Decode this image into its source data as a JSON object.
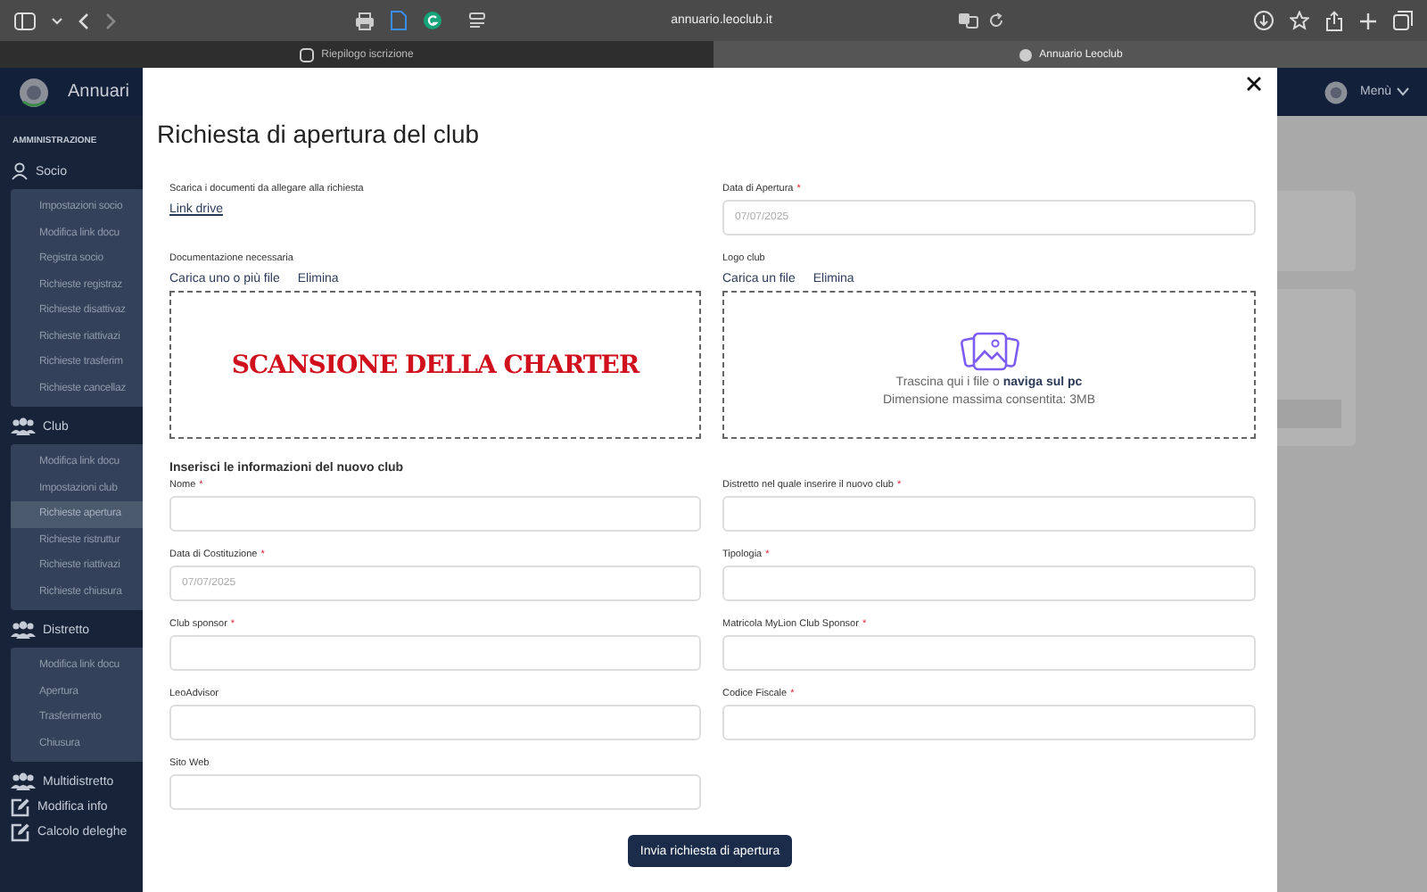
{
  "browser": {
    "url": "annuario.leoclub.it",
    "tabs": [
      {
        "label": "Riepilogo iscrizione",
        "selected": false
      },
      {
        "label": "Annuario Leoclub",
        "selected": true
      }
    ]
  },
  "app_header": {
    "title": "Annuari",
    "menu_label": "Menù"
  },
  "sidebar": {
    "section": "AMMINISTRAZIONE",
    "items": [
      {
        "label": "Socio",
        "kind": "person",
        "children": [
          {
            "label": "Impostazioni socio",
            "selected": false
          },
          {
            "label": "Modifica link docu",
            "selected": false
          },
          {
            "label": "Registra socio",
            "selected": false
          },
          {
            "label": "Richieste registraz",
            "selected": false
          },
          {
            "label": "Richieste disattivaz",
            "selected": false
          },
          {
            "label": "Richieste riattivazi",
            "selected": false
          },
          {
            "label": "Richieste trasferim",
            "selected": false
          },
          {
            "label": "Richieste cancellaz",
            "selected": false
          }
        ]
      },
      {
        "label": "Club",
        "kind": "group",
        "children": [
          {
            "label": "Modifica link docu",
            "selected": false
          },
          {
            "label": "Impostazioni club",
            "selected": false
          },
          {
            "label": "Richieste apertura",
            "selected": true
          },
          {
            "label": "Richieste ristruttur",
            "selected": false
          },
          {
            "label": "Richieste riattivazi",
            "selected": false
          },
          {
            "label": "Richieste chiusura",
            "selected": false
          }
        ]
      },
      {
        "label": "Distretto",
        "kind": "group",
        "children": [
          {
            "label": "Modifica link docu",
            "selected": false
          },
          {
            "label": "Apertura",
            "selected": false
          },
          {
            "label": "Trasferimento",
            "selected": false
          },
          {
            "label": "Chiusura",
            "selected": false
          }
        ]
      },
      {
        "label": "Multidistretto",
        "kind": "group"
      },
      {
        "label": "Modifica info",
        "kind": "edit"
      },
      {
        "label": "Calcolo deleghe",
        "kind": "edit"
      }
    ]
  },
  "modal": {
    "title": "Richiesta di apertura del club",
    "docs": {
      "label": "Scarica i documenti da allegare alla richiesta",
      "link": "Link drive"
    },
    "opening_date": {
      "label": "Data di Apertura",
      "required_mark": "*",
      "value": "07/07/2025"
    },
    "documentation": {
      "label": "Documentazione necessaria",
      "upload": "Carica uno o più file",
      "remove": "Elimina",
      "content": "SCANSIONE DELLA CHARTER"
    },
    "logo": {
      "label": "Logo club",
      "upload": "Carica un file",
      "remove": "Elimina",
      "drop_text": "Trascina qui i file o **naviga sul pc**",
      "size_note": "Dimensione massima consentita: 3MB"
    },
    "section_title": "Inserisci le informazioni del nuovo club",
    "fields": [
      {
        "label": "Nome",
        "required_mark": "*"
      },
      {
        "label": "Distretto nel quale inserire il nuovo club",
        "required_mark": "*"
      },
      {
        "label": "Data di Costituzione",
        "required_mark": "*",
        "value": "07/07/2025"
      },
      {
        "label": "Tipologia",
        "required_mark": "*"
      },
      {
        "label": "Club sponsor",
        "required_mark": "*"
      },
      {
        "label": "Matricola MyLion Club Sponsor",
        "required_mark": "*"
      },
      {
        "label": "LeoAdvisor"
      },
      {
        "label": "Codice Fiscale",
        "required_mark": "*"
      },
      {
        "label": "Sito Web"
      }
    ],
    "submit": "Invia richiesta di apertura"
  }
}
